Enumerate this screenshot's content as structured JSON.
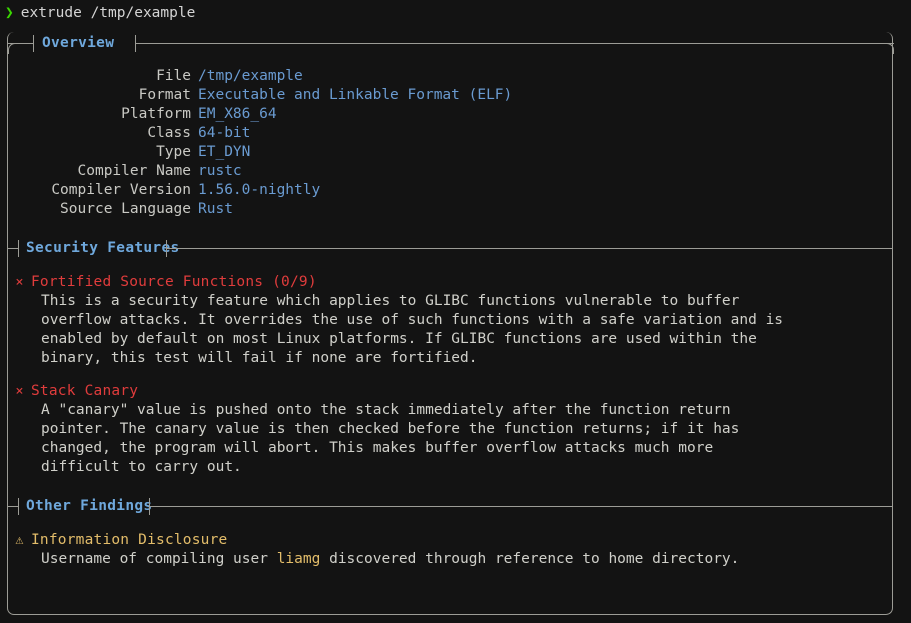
{
  "terminal": {
    "prompt_symbol": "❯",
    "command": "extrude /tmp/example",
    "prompt_color": "#3ad900"
  },
  "panel": {
    "title": "Overview"
  },
  "overview": {
    "rows": [
      {
        "key": "File",
        "value": "/tmp/example"
      },
      {
        "key": "Format",
        "value": "Executable and Linkable Format (ELF)"
      },
      {
        "key": "Platform",
        "value": "EM_X86_64"
      },
      {
        "key": "Class",
        "value": "64-bit"
      },
      {
        "key": "Type",
        "value": "ET_DYN"
      },
      {
        "key": "Compiler Name",
        "value": "rustc"
      },
      {
        "key": "Compiler Version",
        "value": "1.56.0-nightly"
      },
      {
        "key": "Source Language",
        "value": "Rust"
      }
    ]
  },
  "sections": {
    "security_features": {
      "title": "Security Features",
      "findings": [
        {
          "marker": "×",
          "status": "fail",
          "name": "Fortified Source Functions (0/9)",
          "lines": [
            "This is a security feature which applies to GLIBC functions vulnerable to buffer",
            "overflow attacks. It overrides the use of such functions with a safe variation and is",
            "enabled by default on most Linux platforms. If GLIBC functions are used within the",
            "binary, this test will fail if none are fortified."
          ]
        },
        {
          "marker": "×",
          "status": "fail",
          "name": "Stack Canary",
          "lines": [
            "A \"canary\" value is pushed onto the stack immediately after the function return",
            "pointer. The canary value is then checked before the function returns; if it has",
            "changed, the program will abort. This makes buffer overflow attacks much more",
            "difficult to carry out."
          ]
        }
      ]
    },
    "other_findings": {
      "title": "Other Findings",
      "findings": [
        {
          "marker": "⚠",
          "status": "warn",
          "name": "Information Disclosure",
          "desc_prefix": "Username of compiling user ",
          "desc_highlight": "liamg",
          "desc_suffix": " discovered through reference to home directory."
        }
      ]
    }
  },
  "colors": {
    "background": "#131313",
    "border": "#9c9c96",
    "header_blue": "#6fa8dc",
    "value_blue": "#6a9bd1",
    "body_text": "#d0d0ca",
    "fail_red": "#e03c3c",
    "warn_gold": "#e3bd6a",
    "prompt_green": "#3ad900"
  }
}
